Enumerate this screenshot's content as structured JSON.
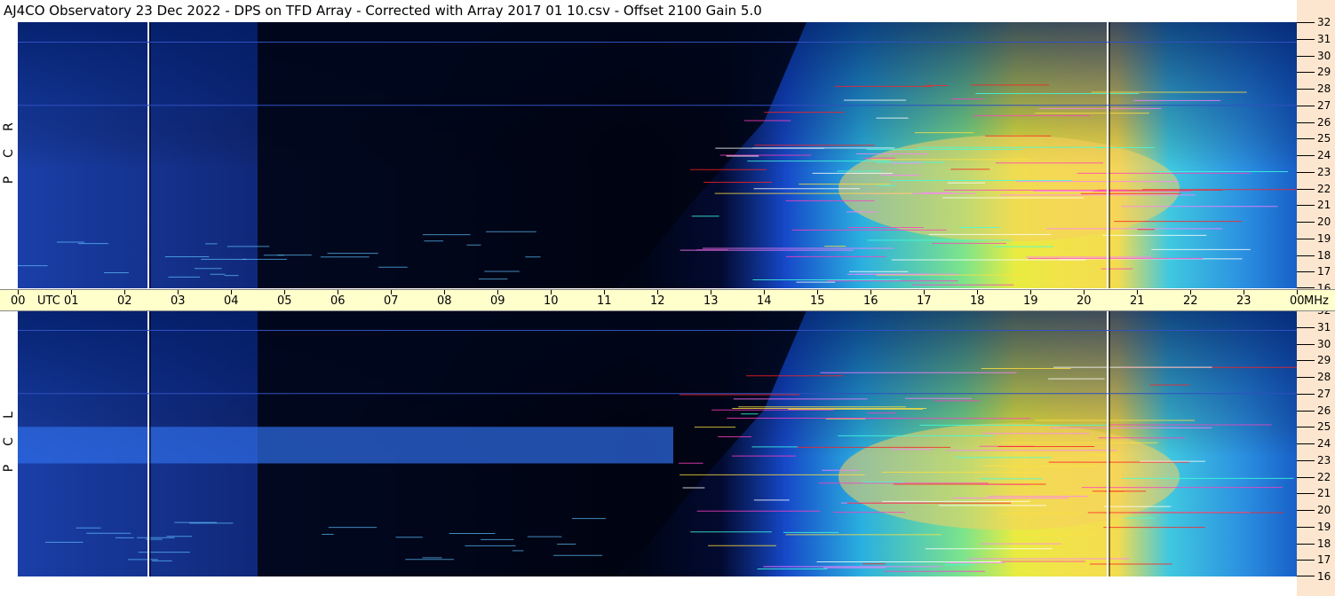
{
  "title": "AJ4CO Observatory  23 Dec 2022  -  DPS on TFD Array  -  Corrected with Array 2017 01 10.csv  -  Offset 2100  Gain 5.0",
  "chart_data": {
    "type": "heatmap",
    "panels": [
      {
        "polarization_label": [
          "R",
          "C",
          "P"
        ]
      },
      {
        "polarization_label": [
          "L",
          "C",
          "P"
        ]
      }
    ],
    "x_axis": {
      "labels": [
        "00",
        "UTC",
        "01",
        "02",
        "03",
        "04",
        "05",
        "06",
        "07",
        "08",
        "09",
        "10",
        "11",
        "12",
        "13",
        "14",
        "15",
        "16",
        "17",
        "18",
        "19",
        "20",
        "21",
        "22",
        "23",
        "00"
      ],
      "hours": [
        0,
        1,
        2,
        3,
        4,
        5,
        6,
        7,
        8,
        9,
        10,
        11,
        12,
        13,
        14,
        15,
        16,
        17,
        18,
        19,
        20,
        21,
        22,
        23,
        24
      ],
      "unit_label": "UTC",
      "range": [
        0,
        24
      ]
    },
    "y_axis": {
      "unit_label": "MHz",
      "ticks": [
        32,
        31,
        30,
        29,
        28,
        27,
        26,
        25,
        24,
        23,
        22,
        21,
        20,
        19,
        18,
        17,
        16
      ],
      "range": [
        16,
        32
      ]
    },
    "features": {
      "vertical_marker_hours": [
        2.45,
        20.45
      ],
      "daylight_start_hour": 12.5,
      "daylight_end_hour": 24
    }
  }
}
